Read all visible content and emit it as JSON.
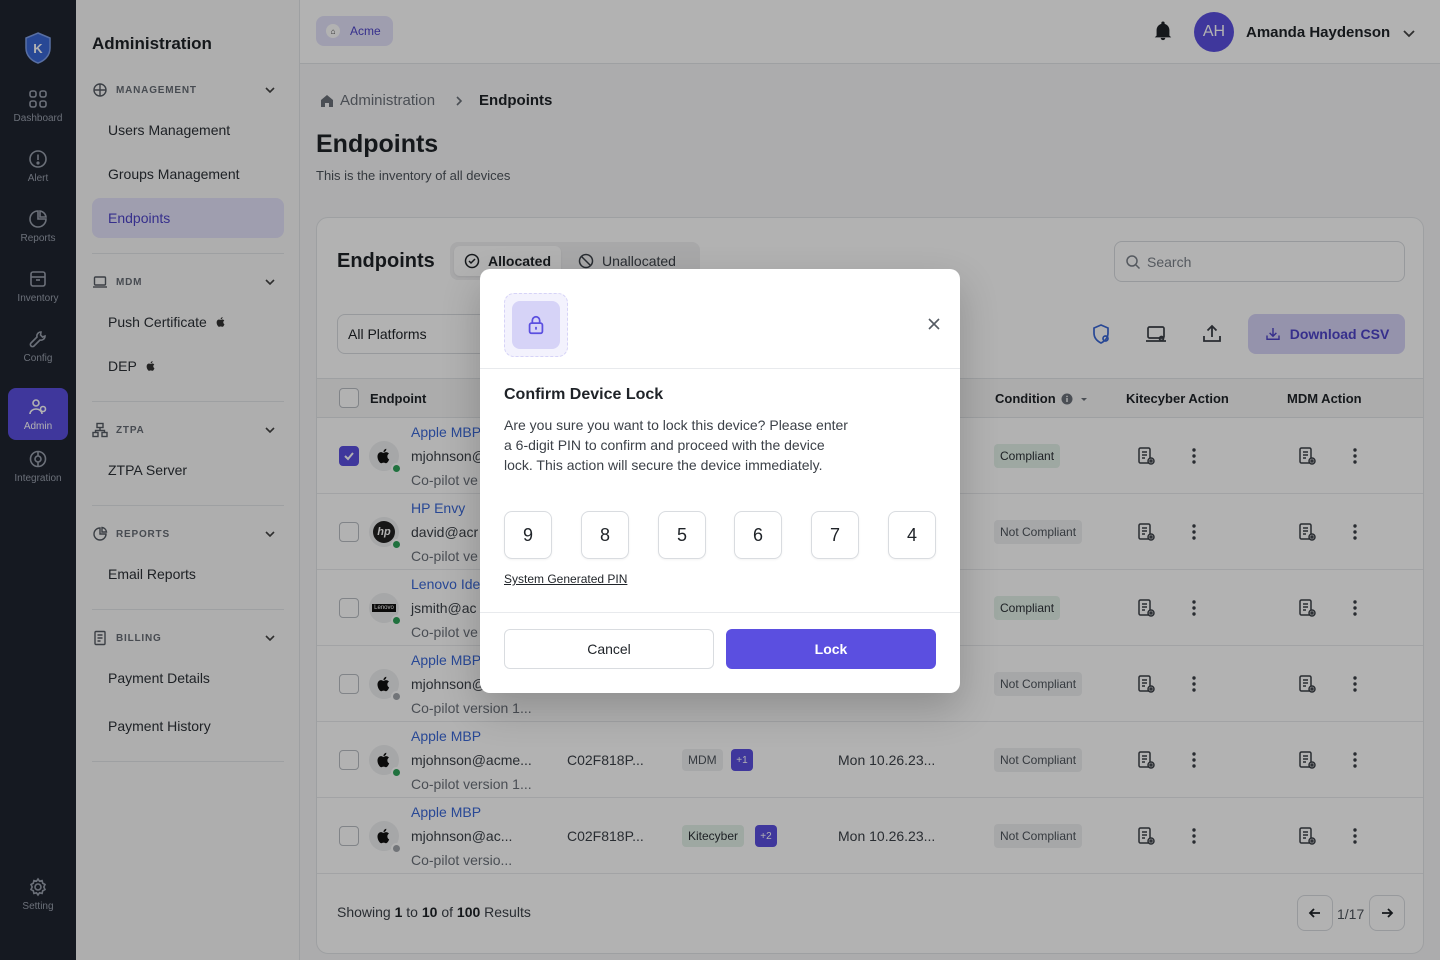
{
  "rail": {
    "items": [
      {
        "label": "Dashboard",
        "icon": "grid-icon"
      },
      {
        "label": "Alert",
        "icon": "alert-icon"
      },
      {
        "label": "Reports",
        "icon": "pie-chart-icon"
      },
      {
        "label": "Inventory",
        "icon": "archive-icon"
      },
      {
        "label": "Config",
        "icon": "wrench-icon"
      },
      {
        "label": "Admin",
        "icon": "users-icon"
      },
      {
        "label": "Integration",
        "icon": "integration-icon"
      }
    ],
    "setting_label": "Setting",
    "active_color": "#5b4fe0"
  },
  "sidebar": {
    "title": "Administration",
    "sections": [
      {
        "label": "MANAGEMENT",
        "items": [
          "Users Management",
          "Groups Management",
          "Endpoints"
        ]
      },
      {
        "label": "MDM",
        "items": [
          "Push Certificate",
          "DEP"
        ]
      },
      {
        "label": "ZTPA",
        "items": [
          "ZTPA Server"
        ]
      },
      {
        "label": "REPORTS",
        "items": [
          "Email Reports"
        ]
      },
      {
        "label": "BILLING",
        "items": [
          "Payment Details",
          "Payment History"
        ]
      }
    ],
    "active_item": "Endpoints"
  },
  "topbar": {
    "org_label": "Acme",
    "user_initials": "AH",
    "user_name": "Amanda Haydenson"
  },
  "breadcrumb": {
    "root": "Administration",
    "current": "Endpoints"
  },
  "page": {
    "title": "Endpoints",
    "subtitle": "This is the inventory of all devices"
  },
  "card": {
    "title": "Endpoints",
    "tabs": [
      {
        "label": "Allocated",
        "active": true
      },
      {
        "label": "Unallocated",
        "active": false
      }
    ],
    "search_placeholder": "Search",
    "platform_select": "All Platforms",
    "download_label": "Download CSV"
  },
  "table": {
    "columns": {
      "endpoint": "Endpoint",
      "condition": "Condition",
      "kitecyber_action": "Kitecyber Action",
      "mdm_action": "MDM Action"
    },
    "rows": [
      {
        "name": "Apple MBP",
        "email": "mjohnson@",
        "version": "Co-pilot ve",
        "serial": "",
        "tag": "",
        "more": "",
        "date": "",
        "condition": "Compliant",
        "os": "apple",
        "online": true,
        "checked": true
      },
      {
        "name": "HP Envy",
        "email": "david@acr",
        "version": "Co-pilot ve",
        "serial": "",
        "tag": "",
        "more": "",
        "date": "",
        "condition": "Not Compliant",
        "os": "hp",
        "online": true,
        "checked": false
      },
      {
        "name": "Lenovo Ide",
        "email": "jsmith@ac",
        "version": "Co-pilot ve",
        "serial": "",
        "tag": "",
        "more": "",
        "date": "",
        "condition": "Compliant",
        "os": "lenovo",
        "online": true,
        "checked": false
      },
      {
        "name": "Apple MBP",
        "email": "mjohnson@",
        "version": "Co-pilot version 1...",
        "serial": "",
        "tag": "",
        "more": "",
        "date": "",
        "condition": "Not Compliant",
        "os": "apple",
        "online": false,
        "checked": false
      },
      {
        "name": "Apple MBP",
        "email": "mjohnson@acme...",
        "version": "Co-pilot version 1...",
        "serial": "C02F818P...",
        "tag": "MDM",
        "more": "+1",
        "date": "Mon 10.26.23...",
        "condition": "Not Compliant",
        "os": "apple",
        "online": true,
        "checked": false
      },
      {
        "name": "Apple MBP",
        "email": "mjohnson@ac...",
        "version": "Co-pilot versio...",
        "serial": "C02F818P...",
        "tag": "Kitecyber",
        "more": "+2",
        "date": "Mon 10.26.23...",
        "condition": "Not Compliant",
        "os": "apple",
        "online": false,
        "checked": false
      }
    ]
  },
  "pagination": {
    "prefix": "Showing",
    "from": "1",
    "to_word": "to",
    "to": "10",
    "of_word": "of",
    "total": "100",
    "suffix": "Results",
    "page_label": "1/17"
  },
  "modal": {
    "title": "Confirm Device Lock",
    "body": "Are you sure you want to lock this device? Please enter a 6-digit PIN to confirm and proceed with the device lock. This action will secure the device immediately.",
    "pin": [
      "9",
      "8",
      "5",
      "6",
      "7",
      "4"
    ],
    "pin_link": "System Generated PIN",
    "cancel_label": "Cancel",
    "lock_label": "Lock"
  }
}
